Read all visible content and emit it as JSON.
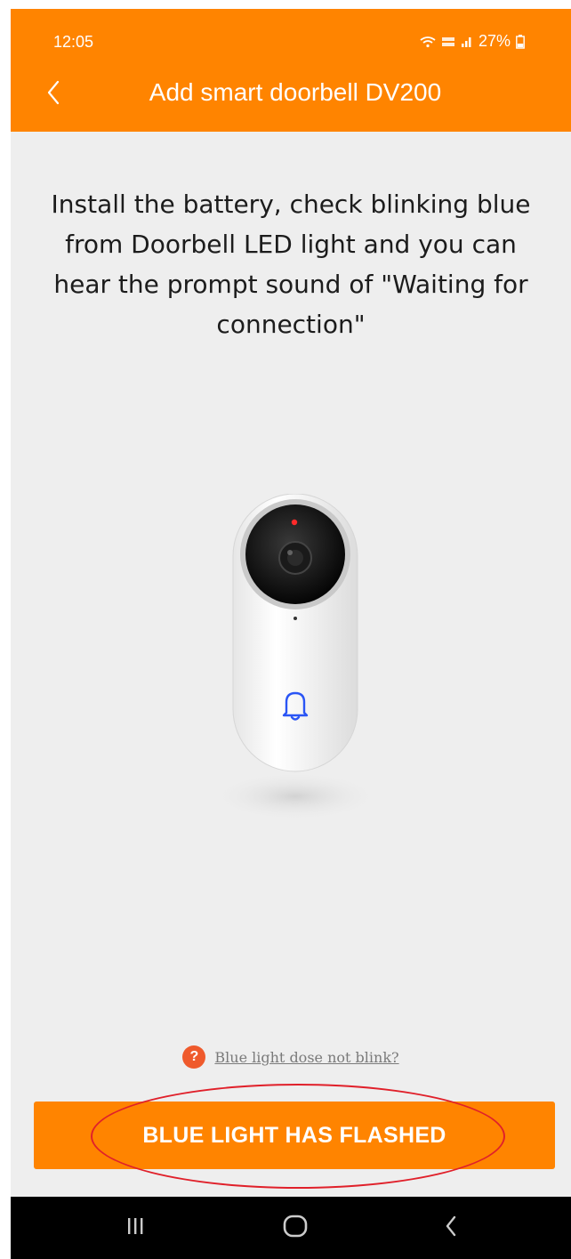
{
  "status_bar": {
    "time": "12:05",
    "battery": "27%",
    "icons": [
      "wifi-icon",
      "volte-icon",
      "signal-icon",
      "battery-icon"
    ]
  },
  "header": {
    "title": "Add smart doorbell DV200",
    "back_icon": "chevron-left-icon",
    "background_color": "#ff8400"
  },
  "main": {
    "instructions": "Install the battery, check blinking blue from Doorbell LED light and you can hear the prompt sound of \"Waiting for connection\"",
    "device_image": "doorbell-illustration",
    "help_link": "Blue light dose not blink?",
    "help_icon": "question-circle-icon",
    "primary_button": "BLUE LIGHT HAS FLASHED"
  },
  "colors": {
    "accent": "#ff8400",
    "annotation_circle": "#e0202a",
    "help_icon": "#ef5a2c",
    "bell_icon": "#2a55f5"
  },
  "nav_bar": {
    "items": [
      "recent-apps-icon",
      "home-icon",
      "back-icon"
    ]
  }
}
